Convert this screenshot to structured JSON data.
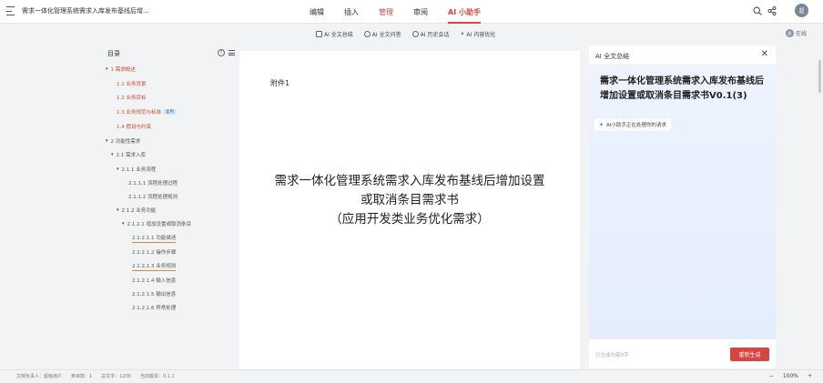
{
  "header": {
    "doc_title": "需求一体化管理系统需求入库发布基线后增...",
    "tabs": [
      {
        "label": "编辑"
      },
      {
        "label": "插入"
      },
      {
        "label": "管理"
      },
      {
        "label": "审阅"
      },
      {
        "label": "AI 小助手"
      }
    ],
    "avatar_text": "超"
  },
  "toolbar": {
    "items": [
      {
        "label": "AI 全文总结",
        "icon": "document-icon"
      },
      {
        "label": "AI 全文问答",
        "icon": "question-icon"
      },
      {
        "label": "AI 历史会话",
        "icon": "history-icon"
      },
      {
        "label": "AI 内容优化",
        "icon": "sparkle-icon"
      }
    ],
    "online_label": "在线"
  },
  "outline": {
    "title": "目录",
    "items": [
      {
        "label": "1 需求概述"
      },
      {
        "label": "1.1 业务背景"
      },
      {
        "label": "1.2 业务目标"
      },
      {
        "label": "1.3 业务规范与标准",
        "tag": "复用"
      },
      {
        "label": "1.4 假设与约束"
      },
      {
        "label": "2 功能性需求"
      },
      {
        "label": "2.1 需求入库"
      },
      {
        "label": "2.1.1 业务流程"
      },
      {
        "label": "2.1.1.1 流程处理过程"
      },
      {
        "label": "2.1.1.2 流程处理规则"
      },
      {
        "label": "2.1.2 业务功能"
      },
      {
        "label": "2.1.2.1 增加设置或取消条目"
      },
      {
        "label": "2.1.2.1.1 功能描述"
      },
      {
        "label": "2.1.2.1.2 操作步骤"
      },
      {
        "label": "2.1.2.1.3 业务规则"
      },
      {
        "label": "2.1.2.1.4 输入信息"
      },
      {
        "label": "2.1.2.1.5 输出信息"
      },
      {
        "label": "2.1.2.1.6 异常处理"
      }
    ]
  },
  "document": {
    "attachment": "附件1",
    "title_line1": "需求一体化管理系统需求入库发布基线后增加设置",
    "title_line2": "或取消条目需求书",
    "title_line3": "（应用开发类业务优化需求）"
  },
  "ai_panel": {
    "title": "AI 全文总结",
    "doc_title": "需求一体化管理系统需求入库发布基线后增加设置或取消条目需求书V0.1(3)",
    "status": "AI小助手正在处理你的请求",
    "generated_count": "已生成内容0字",
    "regenerate_label": "重新生成"
  },
  "statusbar": {
    "owner": "文档负责人：超级用户",
    "entries": "条目数：1",
    "words": "总文字：1200",
    "version": "当前版本：0.1.1",
    "zoom": "100%",
    "minus": "−",
    "plus": "+"
  },
  "colors": {
    "accent": "#d64541",
    "outline_active": "#c8502a",
    "ai_panel_bg": "#e8f0fd"
  }
}
